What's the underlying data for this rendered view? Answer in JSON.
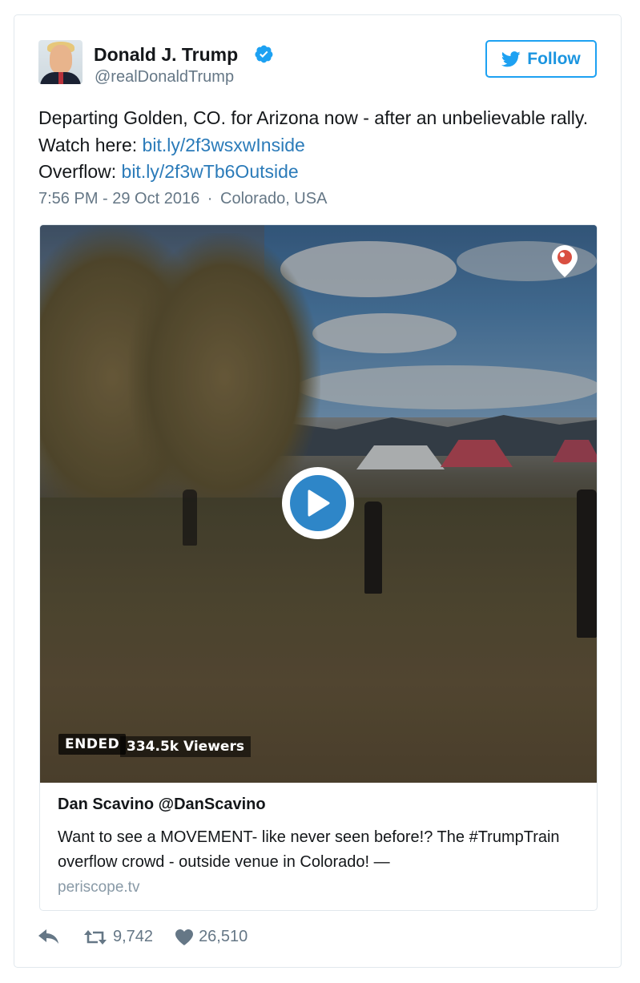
{
  "tweet": {
    "author_name": "Donald J. Trump",
    "author_handle": "@realDonaldTrump",
    "follow_label": "Follow",
    "text_line1": "Departing Golden, CO. for Arizona now - after an unbelievable rally. Watch here: ",
    "link1": "bit.ly/2f3wsxwInside",
    "overflow_label": "Overflow: ",
    "link2": "bit.ly/2f3wTb6Outside",
    "timestamp": "7:56 PM - 29 Oct 2016",
    "separator": "·",
    "location": "Colorado, USA"
  },
  "card": {
    "status_badge": "ENDED",
    "viewers": "334.5k Viewers",
    "title": "Dan Scavino @DanScavino",
    "description": "Want to see a MOVEMENT- like never seen before!? The #TrumpTrain overflow crowd - outside venue in Colorado! —",
    "domain": "periscope.tv"
  },
  "actions": {
    "retweets": "9,742",
    "likes": "26,510"
  },
  "colors": {
    "link": "#2b7bb9",
    "follow_blue": "#1da1f2",
    "play_blue": "#2e86c8",
    "muted": "#657786",
    "periscope_red": "#d94f41"
  },
  "icons": [
    "verified-icon",
    "twitter-bird-icon",
    "periscope-icon",
    "play-icon",
    "reply-icon",
    "retweet-icon",
    "heart-icon"
  ]
}
